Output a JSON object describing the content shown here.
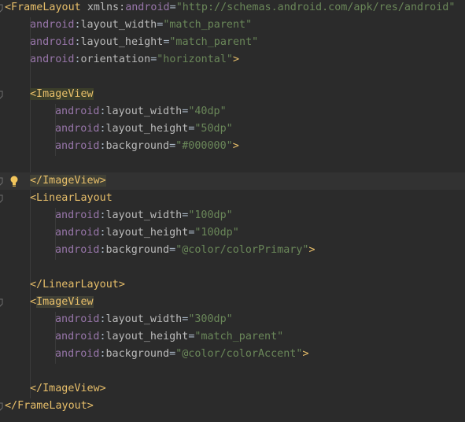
{
  "lines": [
    {
      "parts": [
        [
          "tag",
          "<FrameLayout "
        ],
        [
          "attr",
          "xmlns:"
        ],
        [
          "ns",
          "android"
        ],
        [
          "punct",
          "="
        ],
        [
          "val",
          "\"http://schemas.android.com/apk/res/android\""
        ]
      ]
    },
    {
      "parts": [
        [
          "ns",
          "android"
        ],
        [
          "punct",
          ":"
        ],
        [
          "attr",
          "layout_width"
        ],
        [
          "punct",
          "="
        ],
        [
          "val",
          "\"match_parent\""
        ]
      ]
    },
    {
      "parts": [
        [
          "ns",
          "android"
        ],
        [
          "punct",
          ":"
        ],
        [
          "attr",
          "layout_height"
        ],
        [
          "punct",
          "="
        ],
        [
          "val",
          "\"match_parent\""
        ]
      ]
    },
    {
      "parts": [
        [
          "ns",
          "android"
        ],
        [
          "punct",
          ":"
        ],
        [
          "attr",
          "orientation"
        ],
        [
          "punct",
          "="
        ],
        [
          "val",
          "\"horizontal\""
        ],
        [
          "tag",
          ">"
        ]
      ]
    },
    {
      "parts": []
    },
    {
      "parts": [
        [
          "tag-hl",
          "<ImageView"
        ]
      ]
    },
    {
      "parts": [
        [
          "ns",
          "android"
        ],
        [
          "punct",
          ":"
        ],
        [
          "attr",
          "layout_width"
        ],
        [
          "punct",
          "="
        ],
        [
          "val",
          "\"40dp\""
        ]
      ]
    },
    {
      "parts": [
        [
          "ns",
          "android"
        ],
        [
          "punct",
          ":"
        ],
        [
          "attr",
          "layout_height"
        ],
        [
          "punct",
          "="
        ],
        [
          "val",
          "\"50dp\""
        ]
      ]
    },
    {
      "parts": [
        [
          "ns",
          "android"
        ],
        [
          "punct",
          ":"
        ],
        [
          "attr",
          "background"
        ],
        [
          "punct",
          "="
        ],
        [
          "val",
          "\"#000000\""
        ],
        [
          "tag",
          ">"
        ]
      ]
    },
    {
      "parts": []
    },
    {
      "parts": [
        [
          "tag-hl2",
          "</ImageView>"
        ]
      ]
    },
    {
      "parts": [
        [
          "tag",
          "<LinearLayout"
        ]
      ]
    },
    {
      "parts": [
        [
          "ns",
          "android"
        ],
        [
          "punct",
          ":"
        ],
        [
          "attr",
          "layout_width"
        ],
        [
          "punct",
          "="
        ],
        [
          "val",
          "\"100dp\""
        ]
      ]
    },
    {
      "parts": [
        [
          "ns",
          "android"
        ],
        [
          "punct",
          ":"
        ],
        [
          "attr",
          "layout_height"
        ],
        [
          "punct",
          "="
        ],
        [
          "val",
          "\"100dp\""
        ]
      ]
    },
    {
      "parts": [
        [
          "ns",
          "android"
        ],
        [
          "punct",
          ":"
        ],
        [
          "attr",
          "background"
        ],
        [
          "punct",
          "="
        ],
        [
          "val",
          "\"@color/colorPrimary\""
        ],
        [
          "tag",
          ">"
        ]
      ]
    },
    {
      "parts": []
    },
    {
      "parts": [
        [
          "tag",
          "</LinearLayout>"
        ]
      ]
    },
    {
      "parts": [
        [
          "tag",
          "<"
        ],
        [
          "tag-hl2",
          "ImageView"
        ]
      ]
    },
    {
      "parts": [
        [
          "ns",
          "android"
        ],
        [
          "punct",
          ":"
        ],
        [
          "attr",
          "layout_width"
        ],
        [
          "punct",
          "="
        ],
        [
          "val",
          "\"300dp\""
        ]
      ]
    },
    {
      "parts": [
        [
          "ns",
          "android"
        ],
        [
          "punct",
          ":"
        ],
        [
          "attr",
          "layout_height"
        ],
        [
          "punct",
          "="
        ],
        [
          "val",
          "\"match_parent\""
        ]
      ]
    },
    {
      "parts": [
        [
          "ns",
          "android"
        ],
        [
          "punct",
          ":"
        ],
        [
          "attr",
          "background"
        ],
        [
          "punct",
          "="
        ],
        [
          "val",
          "\"@color/colorAccent\""
        ],
        [
          "tag",
          ">"
        ]
      ]
    },
    {
      "parts": []
    },
    {
      "parts": [
        [
          "tag",
          "</ImageView>"
        ]
      ]
    },
    {
      "parts": [
        [
          "tag",
          "</FrameLayout>"
        ]
      ]
    }
  ],
  "editor": {
    "current_line": 10,
    "intention_icon": "lightbulb-icon",
    "colors": {
      "background": "#2b2b2b",
      "current_line": "#323232",
      "tag": "#e8bf6a",
      "namespace": "#9876aa",
      "attribute": "#bababa",
      "value": "#6a8759"
    }
  }
}
